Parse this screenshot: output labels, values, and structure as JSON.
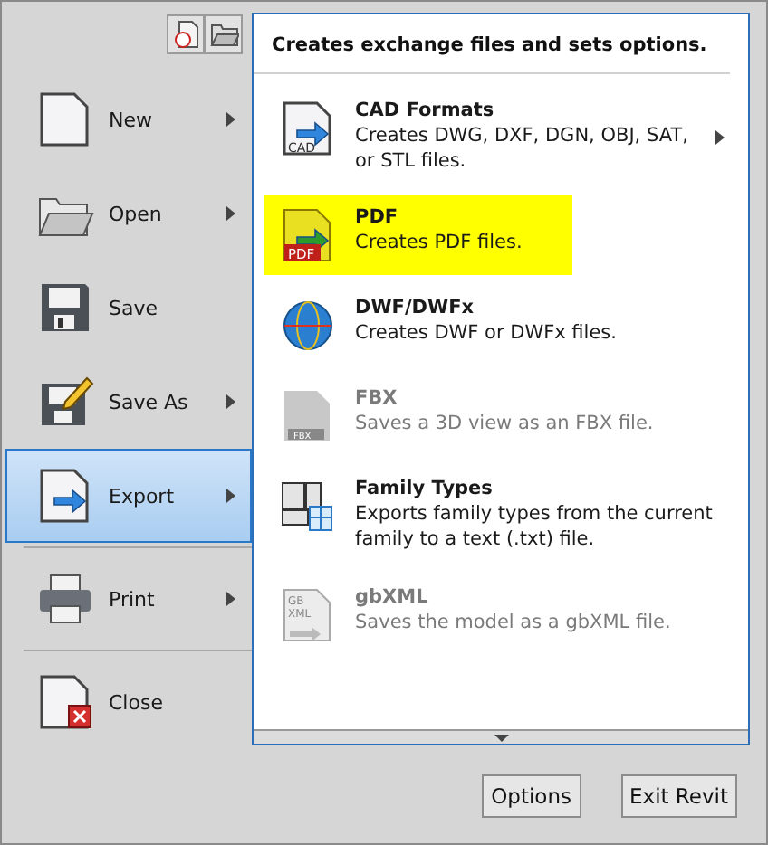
{
  "menu": {
    "items": [
      {
        "kind": "new",
        "label": "New",
        "submenu": true,
        "selected": false
      },
      {
        "kind": "open",
        "label": "Open",
        "submenu": true,
        "selected": false
      },
      {
        "kind": "save",
        "label": "Save",
        "submenu": false,
        "selected": false
      },
      {
        "kind": "saveas",
        "label": "Save As",
        "submenu": true,
        "selected": false
      },
      {
        "kind": "export",
        "label": "Export",
        "submenu": true,
        "selected": true
      },
      {
        "kind": "print",
        "label": "Print",
        "submenu": true,
        "selected": false
      },
      {
        "kind": "close",
        "label": "Close",
        "submenu": false,
        "selected": false
      }
    ]
  },
  "submenu": {
    "header": "Creates exchange files and sets options.",
    "items": [
      {
        "kind": "cad",
        "icon_text": [
          "CAD"
        ],
        "title": "CAD Formats",
        "description": "Creates DWG, DXF, DGN, OBJ, SAT, or STL files.",
        "submenu": true,
        "highlighted": false,
        "disabled": false
      },
      {
        "kind": "pdf",
        "icon_text": [
          "PDF"
        ],
        "title": "PDF",
        "description": "Creates PDF files.",
        "submenu": false,
        "highlighted": true,
        "disabled": false
      },
      {
        "kind": "dwf",
        "title": "DWF/DWFx",
        "description": "Creates DWF or DWFx files.",
        "submenu": false,
        "highlighted": false,
        "disabled": false
      },
      {
        "kind": "fbx",
        "icon_text": [
          "FBX"
        ],
        "title": "FBX",
        "description": "Saves a 3D view as an FBX file.",
        "submenu": false,
        "highlighted": false,
        "disabled": true
      },
      {
        "kind": "family",
        "title": "Family Types",
        "description": "Exports family types from the current family to a text (.txt) file.",
        "submenu": false,
        "highlighted": false,
        "disabled": false
      },
      {
        "kind": "gbxml",
        "icon_text": [
          "GB",
          "XML"
        ],
        "title": "gbXML",
        "description": "Saves the model as a gbXML file.",
        "submenu": false,
        "highlighted": false,
        "disabled": true
      }
    ]
  },
  "buttons": [
    "Options",
    "Exit Revit"
  ]
}
